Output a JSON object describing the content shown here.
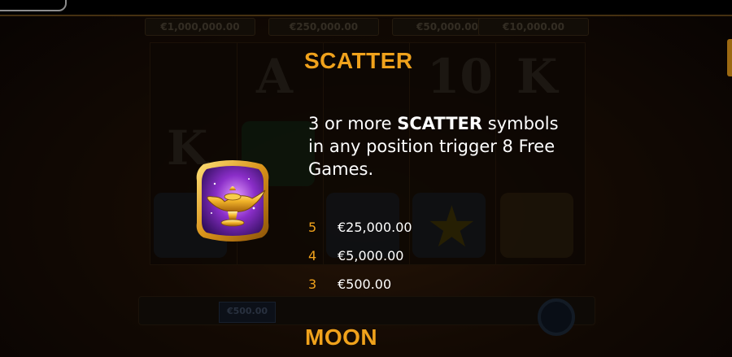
{
  "background": {
    "jackpots": [
      "€1,000,000.00",
      "€250,000.00",
      "€50,000.00",
      "€10,000.00"
    ],
    "bet_value": "€500.00"
  },
  "paytable": {
    "section_title": "SCATTER",
    "description": {
      "part1": "3 or more ",
      "highlight": "SCATTER",
      "part2": " symbols in any position trigger 8 Free Games."
    },
    "symbol_icon": "magic-lamp-icon",
    "payouts": [
      {
        "count": "5",
        "value": "€25,000.00"
      },
      {
        "count": "4",
        "value": "€5,000.00"
      },
      {
        "count": "3",
        "value": "€500.00"
      }
    ],
    "next_section_title": "MOON"
  },
  "colors": {
    "accent": "#f0a21c",
    "text": "#ffffff",
    "background": "#0c0604"
  }
}
